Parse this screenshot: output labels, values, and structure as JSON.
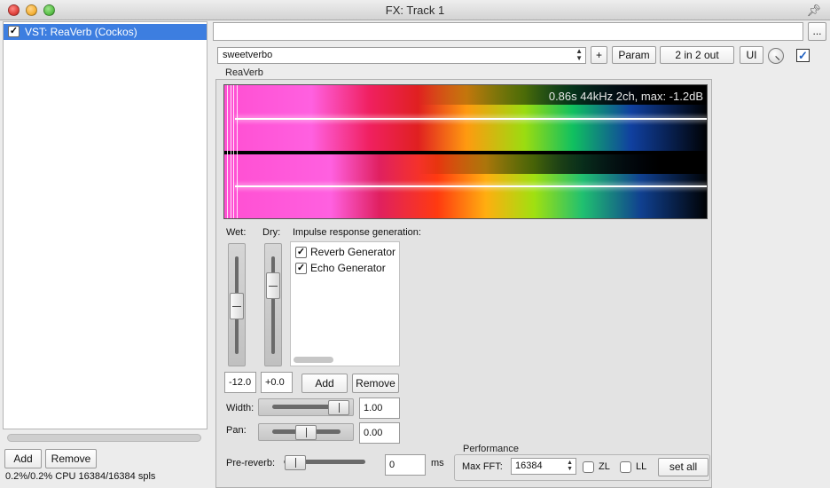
{
  "window": {
    "title": "FX: Track 1",
    "pin_icon": "pin-icon"
  },
  "fx_list": {
    "items": [
      {
        "label": "VST: ReaVerb (Cockos)",
        "enabled": true,
        "selected": true
      }
    ],
    "add_label": "Add",
    "remove_label": "Remove",
    "status": "0.2%/0.2% CPU 16384/16384 spls"
  },
  "toolbar": {
    "browse_label": "...",
    "preset_value": "sweetverbo",
    "plus_label": "+",
    "param_label": "Param",
    "io_label": "2 in 2 out",
    "ui_label": "UI",
    "knob_icon": "wet-knob-icon",
    "enabled_checked": true
  },
  "plugin": {
    "name": "ReaVerb",
    "spectrogram_info": "0.86s 44kHz 2ch, max: -1.2dB",
    "wet": {
      "label": "Wet:",
      "value": "-12.0"
    },
    "dry": {
      "label": "Dry:",
      "value": "+0.0"
    },
    "ir": {
      "label": "Impulse response generation:",
      "items": [
        {
          "label": "Reverb Generator",
          "checked": true
        },
        {
          "label": "Echo Generator",
          "checked": true
        }
      ],
      "add_label": "Add",
      "remove_label": "Remove"
    },
    "width": {
      "label": "Width:",
      "value": "1.00"
    },
    "pan": {
      "label": "Pan:",
      "value": "0.00"
    },
    "prereverb": {
      "label": "Pre-reverb:",
      "value": "0",
      "unit": "ms"
    },
    "performance": {
      "label": "Performance",
      "max_fft_label": "Max FFT:",
      "max_fft_value": "16384",
      "zl_label": "ZL",
      "ll_label": "LL",
      "set_all_label": "set all"
    }
  }
}
